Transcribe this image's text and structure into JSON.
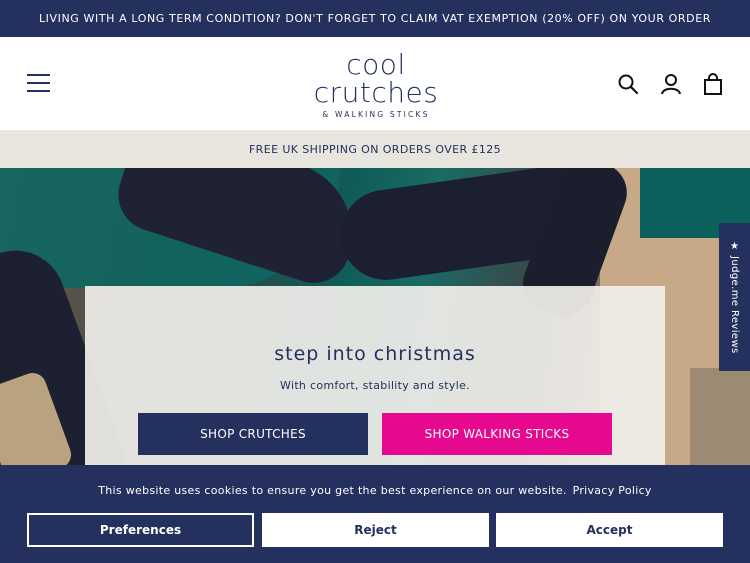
{
  "announcement": {
    "text": "LIVING WITH A LONG TERM CONDITION? DON'T FORGET TO CLAIM VAT EXEMPTION (20% OFF) ON YOUR ORDER"
  },
  "header": {
    "logo_line1": "cool",
    "logo_line2": "crutches",
    "logo_line3": "& WALKING STICKS",
    "icons": [
      "menu-icon",
      "search-icon",
      "account-icon",
      "cart-icon"
    ]
  },
  "shipping_bar": {
    "text": "FREE UK SHIPPING ON ORDERS OVER £125"
  },
  "hero": {
    "title": "step into christmas",
    "subtitle": "With comfort, stability and style.",
    "btn_crutches": "SHOP CRUTCHES",
    "btn_sticks": "SHOP WALKING STICKS"
  },
  "reviews_tab": {
    "label": "★ Judge.me Reviews"
  },
  "cookie_banner": {
    "message": "This website uses cookies to ensure you get the best experience on our website.",
    "policy_link": "Privacy Policy",
    "preferences": "Preferences",
    "reject": "Reject",
    "accept": "Accept"
  },
  "colors": {
    "navy": "#24305e",
    "pink": "#e6088e",
    "beige": "#e8e4de"
  }
}
